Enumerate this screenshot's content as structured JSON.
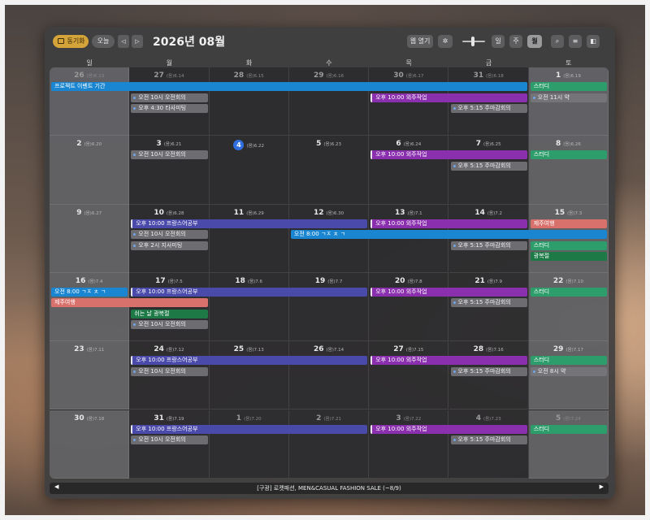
{
  "toolbar": {
    "sync_label": "동기화",
    "today_label": "오늘",
    "prev_glyph": "◁",
    "next_glyph": "▷",
    "title": "2026년 08월",
    "open_label": "웹 열기",
    "pin_glyph": "✲",
    "view_day": "일",
    "view_week": "주",
    "view_month": "월",
    "search_glyph": "⌕",
    "list_glyph": "≡",
    "side_glyph": "◧"
  },
  "weekdays": [
    "일",
    "월",
    "화",
    "수",
    "목",
    "금",
    "토"
  ],
  "days": [
    {
      "n": "26",
      "lunar": "(음)6.13",
      "dim": true
    },
    {
      "n": "27",
      "lunar": "(음)6.14",
      "dim": true
    },
    {
      "n": "28",
      "lunar": "(음)6.15",
      "dim": true
    },
    {
      "n": "29",
      "lunar": "(음)6.16",
      "dim": true
    },
    {
      "n": "30",
      "lunar": "(음)6.17",
      "dim": true
    },
    {
      "n": "31",
      "lunar": "(음)6.18",
      "dim": true
    },
    {
      "n": "1",
      "lunar": "(음)6.19",
      "dim": false
    },
    {
      "n": "2",
      "lunar": "(음)6.20",
      "dim": false
    },
    {
      "n": "3",
      "lunar": "(음)6.21",
      "dim": false
    },
    {
      "n": "4",
      "lunar": "(음)6.22",
      "dim": false,
      "today": true
    },
    {
      "n": "5",
      "lunar": "(음)6.23",
      "dim": false
    },
    {
      "n": "6",
      "lunar": "(음)6.24",
      "dim": false
    },
    {
      "n": "7",
      "lunar": "(음)6.25",
      "dim": false
    },
    {
      "n": "8",
      "lunar": "(음)6.26",
      "dim": false
    },
    {
      "n": "9",
      "lunar": "(음)6.27",
      "dim": false
    },
    {
      "n": "10",
      "lunar": "(음)6.28",
      "dim": false
    },
    {
      "n": "11",
      "lunar": "(음)6.29",
      "dim": false
    },
    {
      "n": "12",
      "lunar": "(음)6.30",
      "dim": false
    },
    {
      "n": "13",
      "lunar": "(음)7.1",
      "dim": false
    },
    {
      "n": "14",
      "lunar": "(음)7.2",
      "dim": false
    },
    {
      "n": "15",
      "lunar": "(음)7.3",
      "dim": false
    },
    {
      "n": "16",
      "lunar": "(음)7.4",
      "dim": false
    },
    {
      "n": "17",
      "lunar": "(음)7.5",
      "dim": false
    },
    {
      "n": "18",
      "lunar": "(음)7.6",
      "dim": false
    },
    {
      "n": "19",
      "lunar": "(음)7.7",
      "dim": false
    },
    {
      "n": "20",
      "lunar": "(음)7.8",
      "dim": false
    },
    {
      "n": "21",
      "lunar": "(음)7.9",
      "dim": false
    },
    {
      "n": "22",
      "lunar": "(음)7.10",
      "dim": false
    },
    {
      "n": "23",
      "lunar": "(음)7.11",
      "dim": false
    },
    {
      "n": "24",
      "lunar": "(음)7.12",
      "dim": false
    },
    {
      "n": "25",
      "lunar": "(음)7.13",
      "dim": false
    },
    {
      "n": "26",
      "lunar": "(음)7.14",
      "dim": false
    },
    {
      "n": "27",
      "lunar": "(음)7.15",
      "dim": false
    },
    {
      "n": "28",
      "lunar": "(음)7.16",
      "dim": false
    },
    {
      "n": "29",
      "lunar": "(음)7.17",
      "dim": false
    },
    {
      "n": "30",
      "lunar": "(음)7.18",
      "dim": false
    },
    {
      "n": "31",
      "lunar": "(음)7.19",
      "dim": false
    },
    {
      "n": "1",
      "lunar": "(음)7.20",
      "dim": true
    },
    {
      "n": "2",
      "lunar": "(음)7.21",
      "dim": true
    },
    {
      "n": "3",
      "lunar": "(음)7.22",
      "dim": true
    },
    {
      "n": "4",
      "lunar": "(음)7.23",
      "dim": true
    },
    {
      "n": "5",
      "lunar": "(음)7.24",
      "dim": true
    }
  ],
  "colors": {
    "project": "#1a86d1",
    "outside": "#8a2fae",
    "study": "#2d9d6b",
    "french": "#4a4aaa",
    "trip": "#d8706c",
    "holiday": "#1d7a47",
    "jeju_time": "#1a86d1",
    "dot": "#6fa6ea"
  },
  "events": [
    {
      "week": 0,
      "start": 0,
      "span": 6,
      "lane": 0,
      "text": "프로젝트 이벤트 기간",
      "kind": "bar",
      "color": "project"
    },
    {
      "week": 0,
      "start": 6,
      "span": 1,
      "lane": 0,
      "text": "스터디",
      "kind": "bar",
      "color": "study"
    },
    {
      "week": 0,
      "start": 6,
      "span": 1,
      "lane": 1,
      "text": "오전 11시   약",
      "kind": "dot"
    },
    {
      "week": 0,
      "start": 1,
      "span": 1,
      "lane": 1,
      "text": "오전 10시   오전회의",
      "kind": "dot"
    },
    {
      "week": 0,
      "start": 1,
      "span": 1,
      "lane": 2,
      "text": "오후 4:30   타사미팅",
      "kind": "dot"
    },
    {
      "week": 0,
      "start": 4,
      "span": 2,
      "lane": 1,
      "text": "오후 10:00 외주작업",
      "kind": "bar",
      "color": "outside",
      "left": true
    },
    {
      "week": 0,
      "start": 5,
      "span": 1,
      "lane": 2,
      "text": "오후 5:15   주마감회의",
      "kind": "dot"
    },
    {
      "week": 1,
      "start": 1,
      "span": 1,
      "lane": 0,
      "text": "오전 10시   오전회의",
      "kind": "dot"
    },
    {
      "week": 1,
      "start": 4,
      "span": 2,
      "lane": 0,
      "text": "오후 10:00 외주작업",
      "kind": "bar",
      "color": "outside",
      "left": true
    },
    {
      "week": 1,
      "start": 5,
      "span": 1,
      "lane": 1,
      "text": "오후 5:15   주마감회의",
      "kind": "dot"
    },
    {
      "week": 1,
      "start": 6,
      "span": 1,
      "lane": 0,
      "text": "스터디",
      "kind": "bar",
      "color": "study"
    },
    {
      "week": 2,
      "start": 1,
      "span": 3,
      "lane": 0,
      "text": "오후 10:00 프랑스어공부",
      "kind": "bar",
      "color": "french",
      "left": true
    },
    {
      "week": 2,
      "start": 4,
      "span": 2,
      "lane": 0,
      "text": "오후 10:00 외주작업",
      "kind": "bar",
      "color": "outside",
      "left": true
    },
    {
      "week": 2,
      "start": 6,
      "span": 1,
      "lane": 0,
      "text": "제주여행",
      "kind": "bar",
      "color": "trip"
    },
    {
      "week": 2,
      "start": 1,
      "span": 1,
      "lane": 1,
      "text": "오전 10시   오전회의",
      "kind": "dot"
    },
    {
      "week": 2,
      "start": 3,
      "span": 4,
      "lane": 1,
      "text": "오전 8:00  ㄱㅈ ㅊ ㄱ",
      "kind": "bar",
      "color": "jeju_time"
    },
    {
      "week": 2,
      "start": 1,
      "span": 1,
      "lane": 2,
      "text": "오후 2시   지사미팅",
      "kind": "dot"
    },
    {
      "week": 2,
      "start": 5,
      "span": 1,
      "lane": 2,
      "text": "오후 5:15   주마감회의",
      "kind": "dot"
    },
    {
      "week": 2,
      "start": 6,
      "span": 1,
      "lane": 2,
      "text": "스터디",
      "kind": "bar",
      "color": "study"
    },
    {
      "week": 2,
      "start": 6,
      "span": 1,
      "lane": 3,
      "text": "광복절",
      "kind": "bar",
      "color": "holiday"
    },
    {
      "week": 3,
      "start": 0,
      "span": 1,
      "lane": 0,
      "text": "오전 8:00  ㄱㅈ ㅊ ㄱ",
      "kind": "bar",
      "color": "jeju_time"
    },
    {
      "week": 3,
      "start": 1,
      "span": 3,
      "lane": 0,
      "text": "오후 10:00 프랑스어공부",
      "kind": "bar",
      "color": "french",
      "left": true
    },
    {
      "week": 3,
      "start": 4,
      "span": 2,
      "lane": 0,
      "text": "오후 10:00 외주작업",
      "kind": "bar",
      "color": "outside",
      "left": true
    },
    {
      "week": 3,
      "start": 6,
      "span": 1,
      "lane": 0,
      "text": "스터디",
      "kind": "bar",
      "color": "study"
    },
    {
      "week": 3,
      "start": 0,
      "span": 2,
      "lane": 1,
      "text": "제주여행",
      "kind": "bar",
      "color": "trip"
    },
    {
      "week": 3,
      "start": 5,
      "span": 1,
      "lane": 1,
      "text": "오후 5:15   주마감회의",
      "kind": "dot"
    },
    {
      "week": 3,
      "start": 1,
      "span": 1,
      "lane": 2,
      "text": "쉬는 날 광복절",
      "kind": "bar",
      "color": "holiday"
    },
    {
      "week": 3,
      "start": 1,
      "span": 1,
      "lane": 3,
      "text": "오전 10시   오전회의",
      "kind": "dot"
    },
    {
      "week": 4,
      "start": 1,
      "span": 3,
      "lane": 0,
      "text": "오후 10:00 프랑스어공부",
      "kind": "bar",
      "color": "french",
      "left": true
    },
    {
      "week": 4,
      "start": 4,
      "span": 2,
      "lane": 0,
      "text": "오후 10:00 외주작업",
      "kind": "bar",
      "color": "outside",
      "left": true
    },
    {
      "week": 4,
      "start": 6,
      "span": 1,
      "lane": 0,
      "text": "스터디",
      "kind": "bar",
      "color": "study"
    },
    {
      "week": 4,
      "start": 1,
      "span": 1,
      "lane": 1,
      "text": "오전 10시   오전회의",
      "kind": "dot"
    },
    {
      "week": 4,
      "start": 5,
      "span": 1,
      "lane": 1,
      "text": "오후 5:15   주마감회의",
      "kind": "dot"
    },
    {
      "week": 4,
      "start": 6,
      "span": 1,
      "lane": 1,
      "text": "오전 8시   약",
      "kind": "dot"
    },
    {
      "week": 5,
      "start": 1,
      "span": 3,
      "lane": 0,
      "text": "오후 10:00 프랑스어공부",
      "kind": "bar",
      "color": "french",
      "left": true
    },
    {
      "week": 5,
      "start": 4,
      "span": 2,
      "lane": 0,
      "text": "오후 10:00 외주작업",
      "kind": "bar",
      "color": "outside",
      "left": true
    },
    {
      "week": 5,
      "start": 6,
      "span": 1,
      "lane": 0,
      "text": "스터디",
      "kind": "bar",
      "color": "study"
    },
    {
      "week": 5,
      "start": 1,
      "span": 1,
      "lane": 1,
      "text": "오전 10시   오전회의",
      "kind": "dot"
    },
    {
      "week": 5,
      "start": 5,
      "span": 1,
      "lane": 1,
      "text": "오후 5:15   주마감회의",
      "kind": "dot"
    }
  ],
  "footer": {
    "prev_glyph": "◀",
    "next_glyph": "▶",
    "ticker": "[구광] 로켓패션, MEN&CASUAL FASHION SALE (~8/9)"
  }
}
